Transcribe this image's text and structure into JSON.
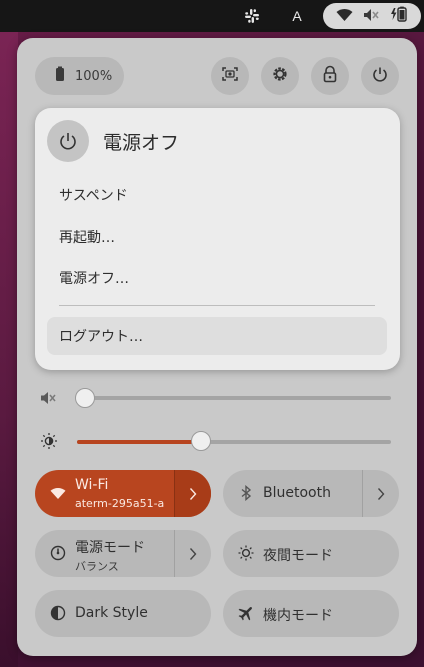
{
  "topbar": {
    "ime_indicator": "A",
    "icons": [
      "slack-icon",
      "wifi-icon",
      "volume-muted-icon",
      "battery-charging-icon"
    ]
  },
  "quick_settings": {
    "battery_percent": "100%",
    "action_buttons": [
      "screenshot-icon",
      "settings-icon",
      "lock-icon",
      "power-icon"
    ]
  },
  "power_menu": {
    "title": "電源オフ",
    "items": [
      {
        "label": "サスペンド"
      },
      {
        "label": "再起動…"
      },
      {
        "label": "電源オフ…"
      },
      {
        "label": "ログアウト…"
      }
    ]
  },
  "sliders": {
    "volume": {
      "level": 0.0,
      "muted": true
    },
    "brightness": {
      "level": 0.38
    }
  },
  "toggles": [
    {
      "label": "Wi-Fi",
      "subtitle": "aterm-295a51-a",
      "active": true
    },
    {
      "label": "Bluetooth",
      "subtitle": "",
      "active": false
    },
    {
      "label": "電源モード",
      "subtitle": "バランス",
      "active": false
    },
    {
      "label": "夜間モード",
      "subtitle": "",
      "active": false
    },
    {
      "label": "Dark Style",
      "subtitle": "",
      "active": false
    },
    {
      "label": "機内モード",
      "subtitle": "",
      "active": false
    }
  ],
  "colors": {
    "accent": "#b8451f",
    "panel": "#c9c9c9",
    "menu": "#ececec",
    "topbar": "#161616"
  }
}
